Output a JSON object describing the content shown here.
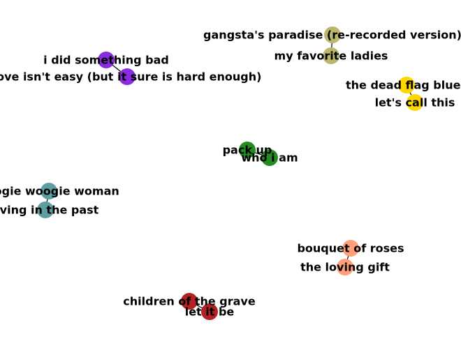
{
  "graph": {
    "nodes": [
      {
        "id": "n1",
        "label": "gangsta's paradise (re-recorded version)",
        "color": "#BDB76B"
      },
      {
        "id": "n2",
        "label": "my favorite ladies",
        "color": "#BDB76B"
      },
      {
        "id": "n3",
        "label": "i did something bad",
        "color": "#8A2BE2"
      },
      {
        "id": "n4",
        "label": "love isn't easy (but it sure is hard enough)",
        "color": "#8A2BE2"
      },
      {
        "id": "n5",
        "label": "the dead flag blues",
        "color": "#FFD700"
      },
      {
        "id": "n6",
        "label": "let's call this",
        "color": "#FFD700"
      },
      {
        "id": "n7",
        "label": "pack up",
        "color": "#228B22"
      },
      {
        "id": "n8",
        "label": "who i am",
        "color": "#228B22"
      },
      {
        "id": "n9",
        "label": "boogie woogie woman",
        "color": "#5F9EA0"
      },
      {
        "id": "n10",
        "label": "living in the past",
        "color": "#5F9EA0"
      },
      {
        "id": "n11",
        "label": "bouquet of roses",
        "color": "#FFA07A"
      },
      {
        "id": "n12",
        "label": "the loving gift",
        "color": "#FFA07A"
      },
      {
        "id": "n13",
        "label": "children of the grave",
        "color": "#B22222"
      },
      {
        "id": "n14",
        "label": "let it be",
        "color": "#B22222"
      }
    ],
    "edges": [
      {
        "source": "n1",
        "target": "n2"
      },
      {
        "source": "n3",
        "target": "n4"
      },
      {
        "source": "n5",
        "target": "n6"
      },
      {
        "source": "n7",
        "target": "n8"
      },
      {
        "source": "n9",
        "target": "n10"
      },
      {
        "source": "n11",
        "target": "n12"
      },
      {
        "source": "n13",
        "target": "n14"
      }
    ]
  }
}
